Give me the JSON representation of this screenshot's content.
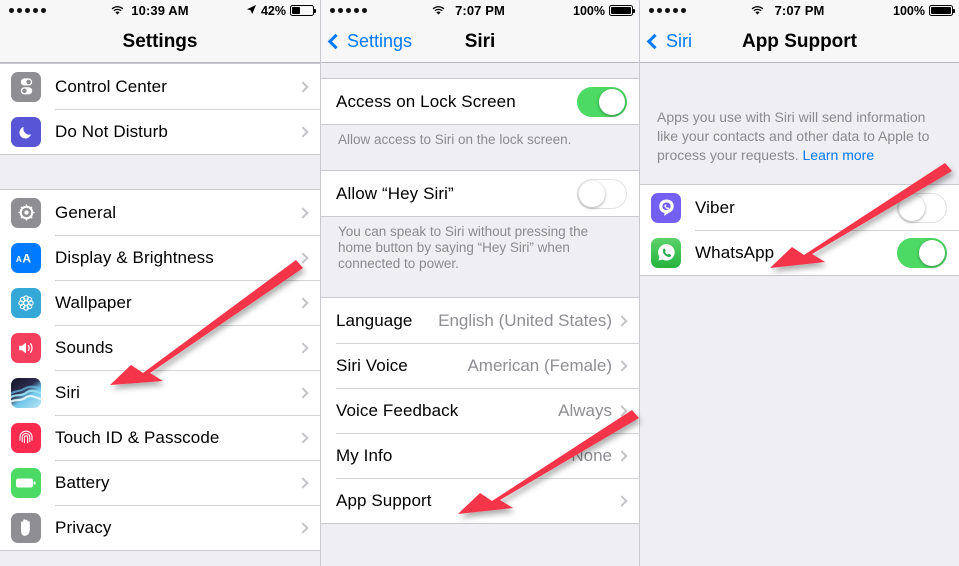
{
  "accent": {
    "blue": "#007aff",
    "green": "#4cd964",
    "arrow_red": "#f4344a",
    "gray_text": "#8e8e93"
  },
  "screens": [
    {
      "id": "settings",
      "status": {
        "carrier_dots": 5,
        "wifi": "wifi-icon",
        "time": "10:39 AM",
        "location": "location-arrow-icon",
        "battery_pct": "42%",
        "battery_level": 42
      },
      "nav": {
        "back": null,
        "title": "Settings"
      },
      "groups": [
        {
          "rows": [
            {
              "icon": "control-center-icon",
              "label": "Control Center",
              "accessory": "chevron"
            },
            {
              "icon": "do-not-disturb-icon",
              "label": "Do Not Disturb",
              "accessory": "chevron"
            }
          ]
        },
        {
          "rows": [
            {
              "icon": "general-icon",
              "label": "General",
              "accessory": "chevron"
            },
            {
              "icon": "display-brightness-icon",
              "label": "Display & Brightness",
              "accessory": "chevron"
            },
            {
              "icon": "wallpaper-icon",
              "label": "Wallpaper",
              "accessory": "chevron"
            },
            {
              "icon": "sounds-icon",
              "label": "Sounds",
              "accessory": "chevron"
            },
            {
              "icon": "siri-icon",
              "label": "Siri",
              "accessory": "chevron"
            },
            {
              "icon": "touch-id-icon",
              "label": "Touch ID & Passcode",
              "accessory": "chevron"
            },
            {
              "icon": "battery-icon",
              "label": "Battery",
              "accessory": "chevron"
            },
            {
              "icon": "privacy-icon",
              "label": "Privacy",
              "accessory": "chevron"
            }
          ]
        }
      ]
    },
    {
      "id": "siri",
      "status": {
        "carrier_dots": 5,
        "wifi": "wifi-icon",
        "time": "7:07 PM",
        "battery_pct": "100%",
        "battery_level": 100
      },
      "nav": {
        "back": "Settings",
        "title": "Siri"
      },
      "rows": {
        "access_lock_screen": {
          "label": "Access on Lock Screen",
          "toggle": "on"
        },
        "access_lock_screen_note": "Allow access to Siri on the lock screen.",
        "hey_siri": {
          "label": "Allow “Hey Siri”",
          "toggle": "off"
        },
        "hey_siri_note": "You can speak to Siri without pressing the home button by saying “Hey Siri” when connected to power.",
        "language": {
          "label": "Language",
          "value": "English (United States)"
        },
        "siri_voice": {
          "label": "Siri Voice",
          "value": "American (Female)"
        },
        "voice_feedback": {
          "label": "Voice Feedback",
          "value": "Always"
        },
        "my_info": {
          "label": "My Info",
          "value": "None"
        },
        "app_support": {
          "label": "App Support",
          "value": ""
        }
      }
    },
    {
      "id": "app-support",
      "status": {
        "carrier_dots": 5,
        "wifi": "wifi-icon",
        "time": "7:07 PM",
        "battery_pct": "100%",
        "battery_level": 100
      },
      "nav": {
        "back": "Siri",
        "title": "App Support"
      },
      "header_note": "Apps you use with Siri will send information like your contacts and other data to Apple to process your requests.",
      "header_link": "Learn more",
      "apps": [
        {
          "icon": "viber-icon",
          "label": "Viber",
          "toggle": "off"
        },
        {
          "icon": "whatsapp-icon",
          "label": "WhatsApp",
          "toggle": "on"
        }
      ]
    }
  ],
  "annotations": [
    {
      "name": "arrow-to-siri",
      "target": "Siri"
    },
    {
      "name": "arrow-to-app-support",
      "target": "App Support"
    },
    {
      "name": "arrow-to-whatsapp",
      "target": "WhatsApp"
    }
  ]
}
